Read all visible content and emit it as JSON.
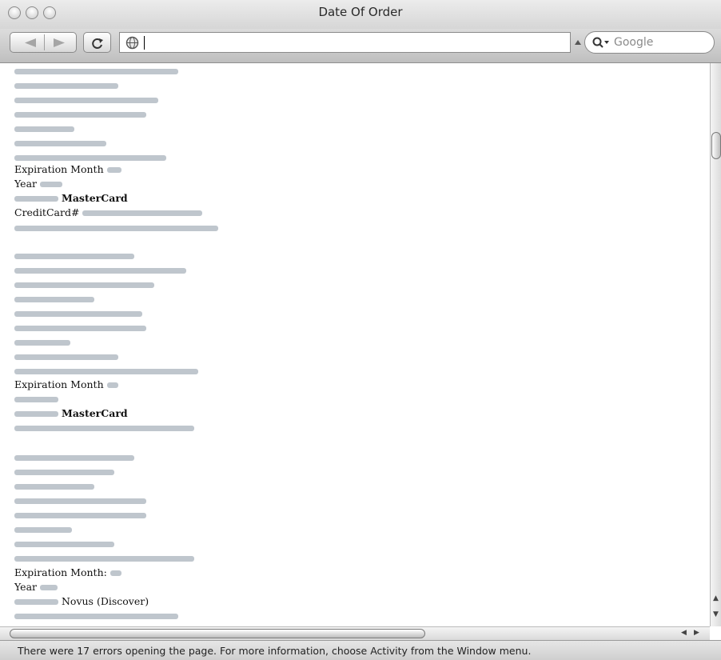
{
  "window": {
    "title": "Date Of Order"
  },
  "toolbar": {
    "back_icon": "back-arrow-icon",
    "forward_icon": "forward-arrow-icon",
    "reload_icon": "reload-icon",
    "site_icon": "globe-icon",
    "address_value": "",
    "search_placeholder": "Google"
  },
  "orders": [
    {
      "labels": [
        "Expiration Month",
        "Year",
        "MasterCard",
        "CreditCard#"
      ]
    },
    {
      "labels": [
        "Expiration Month",
        "MasterCard"
      ]
    },
    {
      "labels": [
        "Expiration Month:",
        "Year",
        "Novus (Discover)"
      ]
    }
  ],
  "status": {
    "message": "There were 17 errors opening the page. For more information, choose Activity from the Window menu."
  },
  "colors": {
    "redaction": "#b4bcc4",
    "chrome": "#d6d6d6"
  }
}
